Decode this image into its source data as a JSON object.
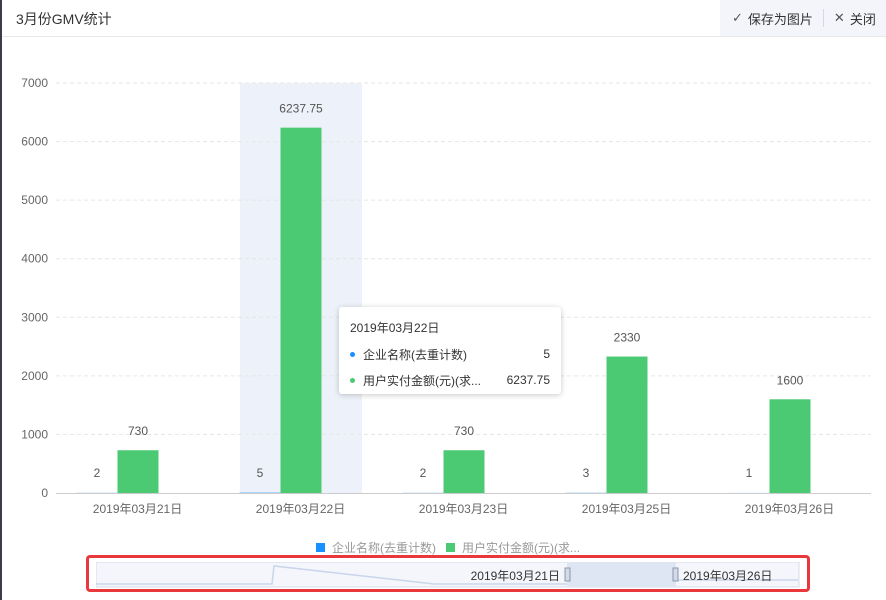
{
  "header": {
    "title": "3月份GMV统计",
    "save_label": "保存为图片",
    "close_label": "关闭"
  },
  "colors": {
    "series_blue": "#1890ff",
    "series_green": "#4cca73",
    "hover_band": "#edf1f9",
    "highlight_border": "#e8383b"
  },
  "chart_data": {
    "type": "bar",
    "categories": [
      "2019年03月21日",
      "2019年03月22日",
      "2019年03月23日",
      "2019年03月25日",
      "2019年03月26日"
    ],
    "series": [
      {
        "name": "企业名称(去重计数)",
        "values": [
          2,
          5,
          2,
          3,
          1
        ]
      },
      {
        "name": "用户实付金额(元)(求...",
        "values": [
          730,
          6237.75,
          730,
          2330,
          1600
        ]
      }
    ],
    "ylim": [
      0,
      7000
    ],
    "yticks": [
      0,
      1000,
      2000,
      3000,
      4000,
      5000,
      6000,
      7000
    ],
    "grid": true,
    "legend_position": "bottom",
    "hovered_category_index": 1
  },
  "tooltip": {
    "title": "2019年03月22日",
    "rows": [
      {
        "name": "企业名称(去重计数)",
        "value": "5"
      },
      {
        "name": "用户实付金额(元)(求...",
        "value": "6237.75"
      }
    ]
  },
  "slider": {
    "start_label": "2019年03月21日",
    "end_label": "2019年03月26日"
  }
}
